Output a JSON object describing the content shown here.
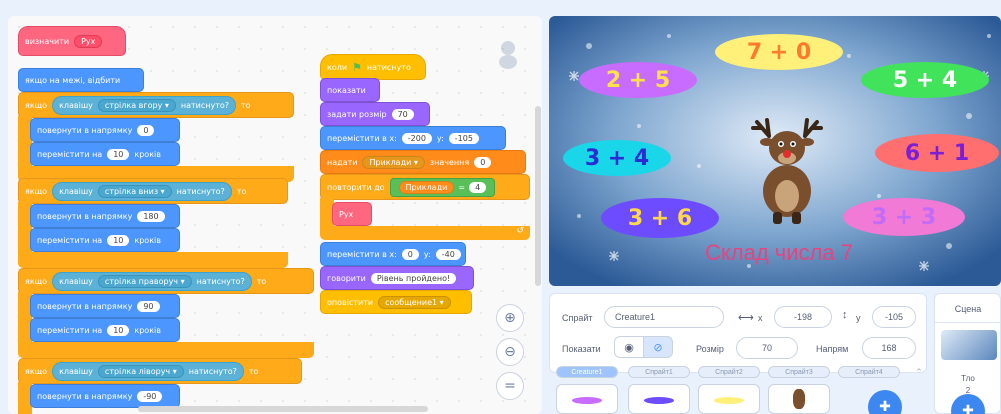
{
  "code": {
    "define": {
      "label": "визначити",
      "name": "Рух"
    },
    "bounce": "якщо на межі, відбити",
    "if_up": {
      "if": "якщо",
      "key_label": "клавішу",
      "key": "стрілка вгору",
      "pressed": "натиснуто?",
      "then": "то",
      "turn": "повернути в напрямку",
      "dir": "0",
      "move": "перемістити на",
      "steps": "10",
      "steps_label": "кроків"
    },
    "if_down": {
      "if": "якщо",
      "key_label": "клавішу",
      "key": "стрілка вниз",
      "pressed": "натиснуто?",
      "then": "то",
      "turn": "повернути в напрямку",
      "dir": "180",
      "move": "перемістити на",
      "steps": "10",
      "steps_label": "кроків"
    },
    "if_right": {
      "if": "якщо",
      "key_label": "клавішу",
      "key": "стрілка праворуч",
      "pressed": "натиснуто?",
      "then": "то",
      "turn": "повернути в напрямку",
      "dir": "90",
      "move": "перемістити на",
      "steps": "10",
      "steps_label": "кроків"
    },
    "if_left": {
      "if": "якщо",
      "key_label": "клавішу",
      "key": "стрілка ліворуч",
      "pressed": "натиснуто?",
      "then": "то",
      "turn": "повернути в напрямку",
      "dir": "-90"
    },
    "script2": {
      "when": "коли",
      "clicked": "натиснуто",
      "show": "показати",
      "set_size": "задати розмір",
      "size": "70",
      "goto": "перемістити в x:",
      "x": "-200",
      "y_label": "y:",
      "y": "-105",
      "set_var": "надати",
      "var": "Приклади",
      "value_label": "значення",
      "value": "0",
      "repeat_until": "повторити до",
      "cond_var": "Приклади",
      "eq": "=",
      "cond_val": "4",
      "call": "Рух",
      "goto2": "перемістити в x:",
      "x2": "0",
      "y2_label": "y:",
      "y2": "-40",
      "say": "говорити",
      "say_text": "Рівень пройдено!",
      "broadcast": "оповістити",
      "message": "сообщение1"
    }
  },
  "stage": {
    "title": "Склад числа 7",
    "ovals": [
      {
        "text": "7 + 0",
        "color": "#fff07a",
        "text_color": "#ff7a2e"
      },
      {
        "text": "2 + 5",
        "color": "#c86bff",
        "text_color": "#ffe14a"
      },
      {
        "text": "5 + 4",
        "color": "#41e35a",
        "text_color": "#ffffff"
      },
      {
        "text": "3 + 4",
        "color": "#19d6e8",
        "text_color": "#2b2bd6"
      },
      {
        "text": "6 + 1",
        "color": "#ff6f6f",
        "text_color": "#7b1fd6"
      },
      {
        "text": "3 + 6",
        "color": "#6d4bff",
        "text_color": "#ffd84a"
      },
      {
        "text": "3 + 3",
        "color": "#f07ad6",
        "text_color": "#c26cf5"
      }
    ]
  },
  "sprite_info": {
    "sprite_label": "Спрайт",
    "sprite_name": "Creature1",
    "x_label": "x",
    "x": "-198",
    "y_label": "y",
    "y": "-105",
    "show_label": "Показати",
    "size_label": "Розмір",
    "size": "70",
    "dir_label": "Напрям",
    "dir": "168"
  },
  "sprite_tabs": [
    "Creature1",
    "Спрайт1",
    "Спрайт2",
    "Спрайт3",
    "Спрайт4"
  ],
  "stage_panel": {
    "title": "Сцена",
    "backdrop_label": "Тло",
    "backdrop_count": "2"
  }
}
